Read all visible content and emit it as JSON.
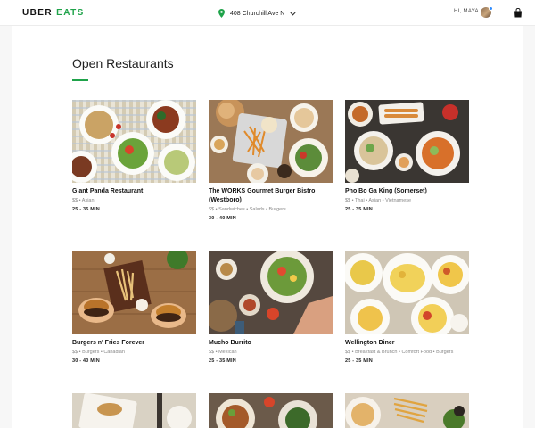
{
  "header": {
    "brand_left": "UBER",
    "brand_right": "EATS",
    "location": "408 Churchill Ave N",
    "greeting": "HI, MAYA"
  },
  "page": {
    "title": "Open Restaurants"
  },
  "restaurants": [
    {
      "name": "Giant Panda Restaurant",
      "tags": "$$ • Asian",
      "eta": "25 - 35 MIN"
    },
    {
      "name": "The WORKS Gourmet Burger Bistro (Westboro)",
      "tags": "$$ • Sandwiches • Salads • Burgers",
      "eta": "30 - 40 MIN"
    },
    {
      "name": "Pho Bo Ga King (Somerset)",
      "tags": "$$ • Thai • Asian • Vietnamese",
      "eta": "25 - 35 MIN"
    },
    {
      "name": "Burgers n' Fries Forever",
      "tags": "$$ • Burgers • Canadian",
      "eta": "30 - 40 MIN"
    },
    {
      "name": "Mucho Burrito",
      "tags": "$$ • Mexican",
      "eta": "25 - 35 MIN"
    },
    {
      "name": "Wellington Diner",
      "tags": "$$ • Breakfast & Brunch • Comfort Food • Burgers",
      "eta": "25 - 35 MIN"
    }
  ],
  "icons": {
    "location": "location-pin-icon",
    "dropdown": "chevron-down-icon",
    "bag": "shopping-bag-icon"
  },
  "colors": {
    "brand_green": "#1fa34a",
    "notification_blue": "#2f8cff"
  }
}
